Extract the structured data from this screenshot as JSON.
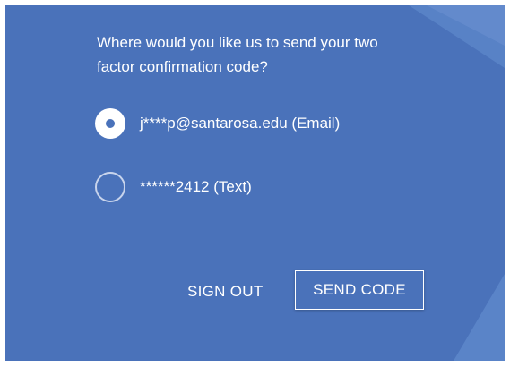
{
  "colors": {
    "panel_bg": "#4a72ba",
    "text": "#ffffff",
    "radio_border": "#c8d4ec"
  },
  "prompt": {
    "line1": "Where would you like us to send your two",
    "line2": "factor confirmation code?"
  },
  "options": [
    {
      "label": "j****p@santarosa.edu (Email)",
      "selected": true
    },
    {
      "label": "******2412 (Text)",
      "selected": false
    }
  ],
  "actions": {
    "sign_out_label": "SIGN OUT",
    "send_code_label": "SEND CODE"
  }
}
